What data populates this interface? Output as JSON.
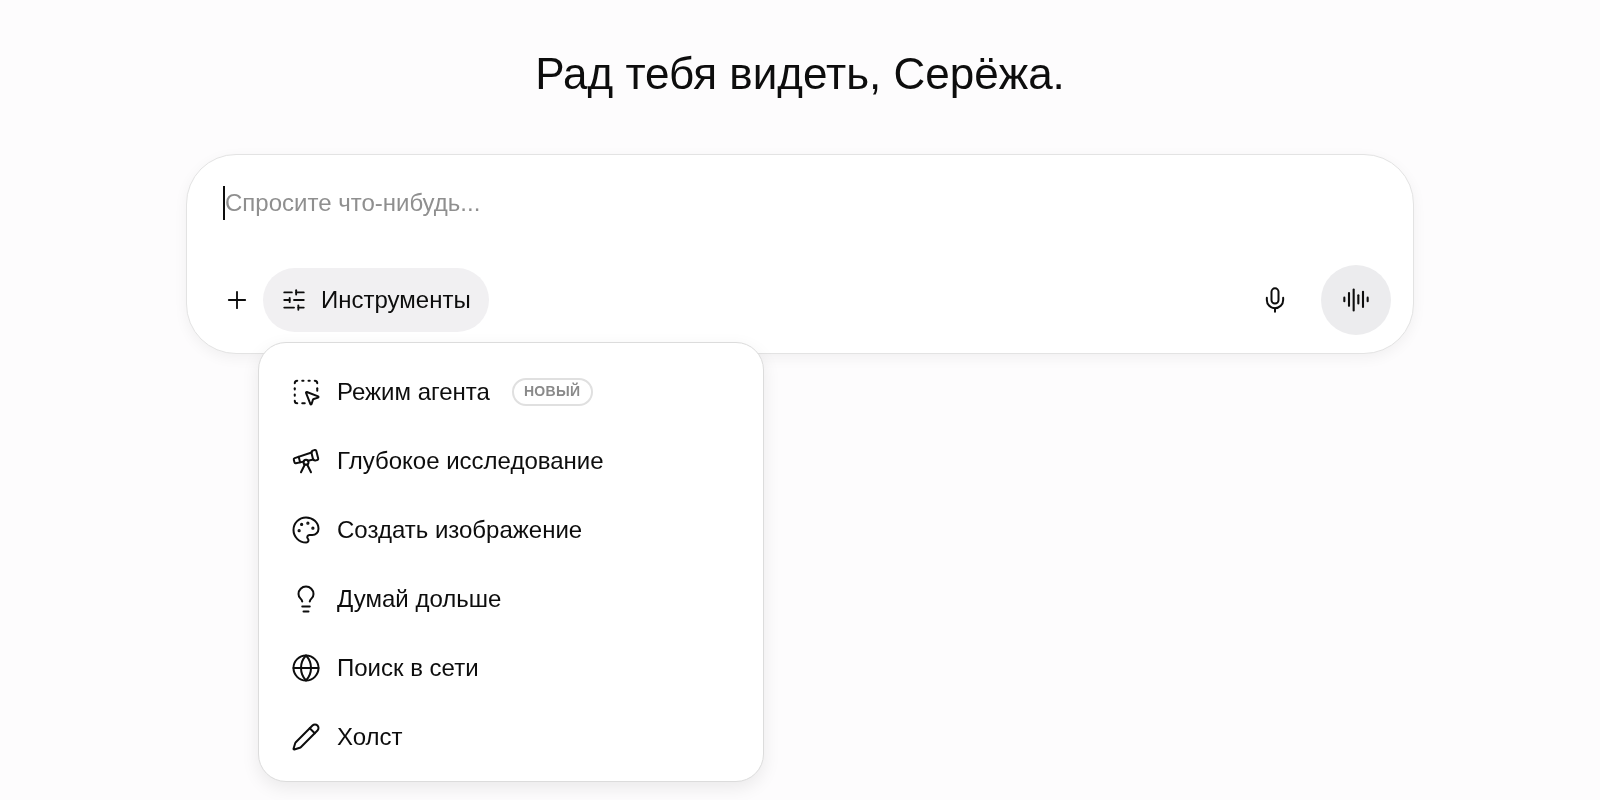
{
  "greeting": "Рад тебя видеть, Серёжа.",
  "composer": {
    "placeholder": "Спросите что-нибудь...",
    "tools_button": "Инструменты"
  },
  "tools_menu": [
    {
      "kind": "agent",
      "label": "Режим агента",
      "badge": "НОВЫЙ"
    },
    {
      "kind": "research",
      "label": "Глубокое исследование"
    },
    {
      "kind": "image",
      "label": "Создать изображение"
    },
    {
      "kind": "think",
      "label": "Думай дольше"
    },
    {
      "kind": "search",
      "label": "Поиск в сети"
    },
    {
      "kind": "canvas",
      "label": "Холст"
    }
  ]
}
